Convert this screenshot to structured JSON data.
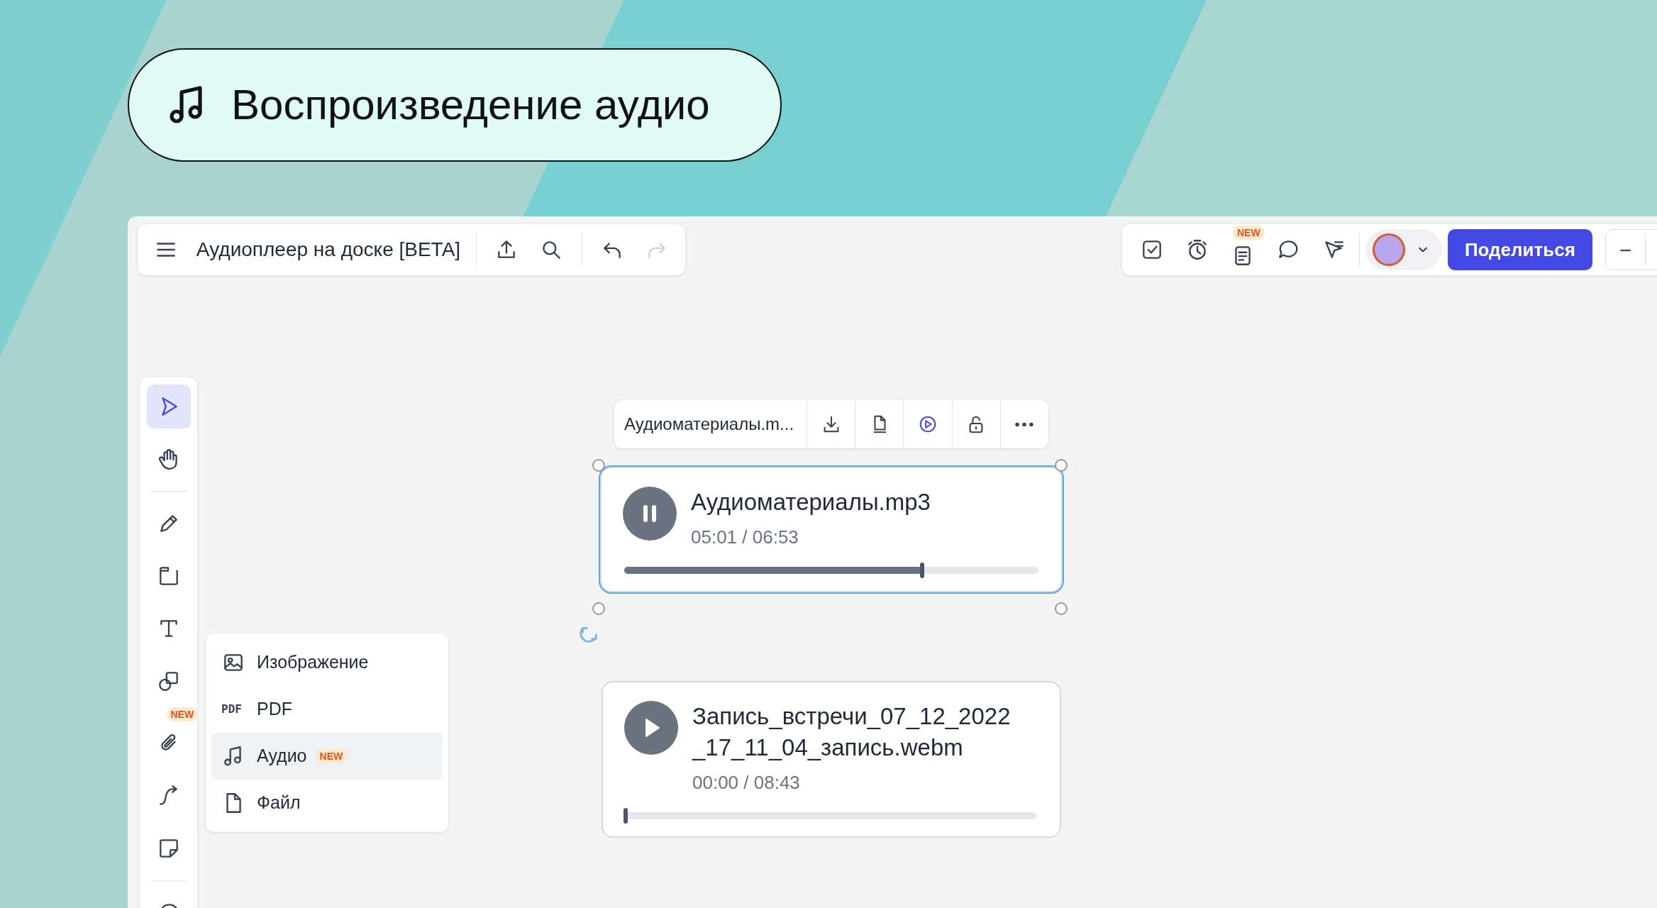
{
  "banner": {
    "title": "Воспроизведение аудио"
  },
  "top_left_toolbar": {
    "board_title": "Аудиоплеер на доске [BETA]",
    "redo_disabled": true
  },
  "top_right_toolbar": {
    "tools": [
      {
        "kind": "task"
      },
      {
        "kind": "timer"
      },
      {
        "kind": "notes",
        "badge": "NEW"
      },
      {
        "kind": "comment"
      },
      {
        "kind": "pointer"
      }
    ],
    "share_button": "Поделиться",
    "zoom_out": "−"
  },
  "left_toolbar": [
    [
      {
        "kind": "select",
        "selected": true
      },
      {
        "kind": "hand",
        "selected": false
      }
    ],
    [
      {
        "kind": "pen",
        "selected": false
      },
      {
        "kind": "frame",
        "selected": false
      },
      {
        "kind": "text",
        "selected": false
      },
      {
        "kind": "shapes",
        "selected": false
      },
      {
        "kind": "attach",
        "selected": false,
        "badge": "NEW"
      },
      {
        "kind": "connector",
        "selected": false
      },
      {
        "kind": "sticky",
        "selected": false
      }
    ],
    [
      {
        "kind": "add-comment",
        "selected": false
      }
    ]
  ],
  "floating_toolbar": {
    "file_name": "Аудиоматериалы.m...",
    "buttons": [
      {
        "kind": "download",
        "selected": false
      },
      {
        "kind": "page",
        "selected": false
      },
      {
        "kind": "play",
        "selected": true
      },
      {
        "kind": "unlock",
        "selected": false
      },
      {
        "kind": "more",
        "selected": false
      }
    ]
  },
  "players": [
    {
      "name": "Аудиоматериалы.mp3",
      "time": "05:01 / 06:53",
      "playing": true,
      "level": 0.72,
      "selected": true
    },
    {
      "name": "Запись_встречи_07_12_2022_17_11_04_запись.webm",
      "time": "00:00 / 08:43",
      "playing": false,
      "level": 0,
      "selected": false
    }
  ],
  "insert_menu": [
    {
      "kind": "image",
      "label": "Изображение",
      "selected": false
    },
    {
      "kind": "pdf",
      "icon_text": "PDF",
      "label": "PDF",
      "selected": false
    },
    {
      "kind": "audio",
      "label": "Аудио",
      "badge": "NEW",
      "selected": true
    },
    {
      "kind": "file",
      "label": "Файл",
      "selected": false
    }
  ]
}
